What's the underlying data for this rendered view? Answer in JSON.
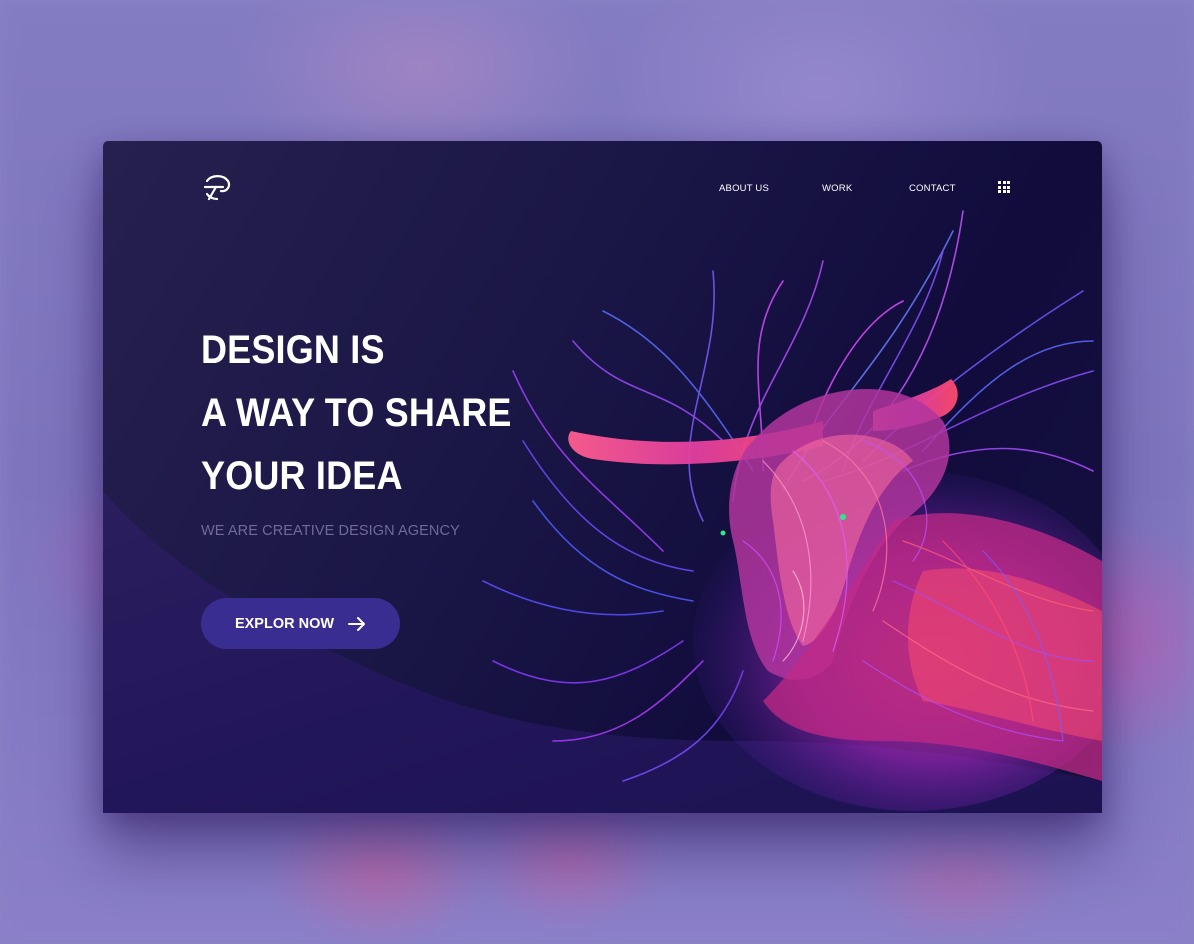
{
  "nav": {
    "items": [
      {
        "label": "ABOUT US"
      },
      {
        "label": "WORK"
      },
      {
        "label": "CONTACT"
      }
    ],
    "menu_icon": "grid-menu-icon",
    "logo_icon": "brand-logo-icon"
  },
  "hero": {
    "headline_lines": [
      "DESIGN IS",
      "A WAY TO SHARE",
      "YOUR IDEA"
    ],
    "subtitle": "WE ARE CREATIVE DESIGN AGENCY",
    "cta_label": "EXPLOR NOW",
    "cta_icon": "arrow-right-icon",
    "illustration": "cable-bull-illustration"
  },
  "colors": {
    "background": "#8a82c6",
    "card": "#1a1645",
    "button": "#3a2d92",
    "subtitle": "#6f6a98",
    "text": "#ffffff"
  }
}
